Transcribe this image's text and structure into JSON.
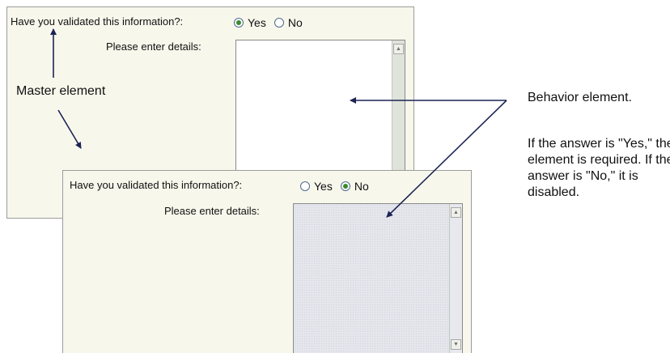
{
  "top_form": {
    "question": "Have you validated this information?:",
    "options": [
      "Yes",
      "No"
    ],
    "selected": "Yes",
    "details_label": "Please enter details:",
    "details_state": "enabled"
  },
  "bottom_form": {
    "question": "Have you validated this information?:",
    "options": [
      "Yes",
      "No"
    ],
    "selected": "No",
    "details_label": "Please enter details:",
    "details_state": "disabled"
  },
  "annotations": {
    "master": "Master element",
    "behavior": "Behavior element.",
    "description": "If the answer is \"Yes,\" the element is required. If the answer is \"No,\" it is disabled."
  },
  "colors": {
    "panel_bg": "#f7f7ec",
    "arrow": "#1c2455",
    "radio_dot": "#3b8a2a",
    "disabled_field": "#e4e6ec"
  }
}
